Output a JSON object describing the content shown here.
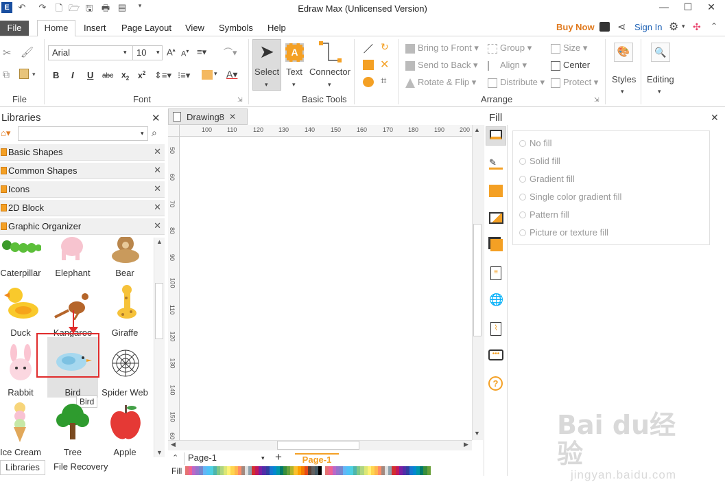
{
  "window": {
    "title": "Edraw Max (Unlicensed Version)"
  },
  "tabs": {
    "file": "File",
    "items": [
      "Home",
      "Insert",
      "Page Layout",
      "View",
      "Symbols",
      "Help"
    ],
    "buy_now": "Buy Now",
    "sign_in": "Sign In"
  },
  "ribbon": {
    "file_group": "File",
    "font": {
      "name": "Arial",
      "size": "10",
      "group": "Font"
    },
    "basic_tools": {
      "select": "Select",
      "text": "Text",
      "connector": "Connector",
      "group": "Basic Tools"
    },
    "arrange": {
      "bring_to_front": "Bring to Front",
      "send_to_back": "Send to Back",
      "rotate_flip": "Rotate & Flip",
      "group_btn": "Group",
      "align": "Align",
      "distribute": "Distribute",
      "size": "Size",
      "center": "Center",
      "protect": "Protect",
      "group": "Arrange"
    },
    "styles": "Styles",
    "editing": "Editing"
  },
  "libraries": {
    "title": "Libraries",
    "categories": [
      "Basic Shapes",
      "Common Shapes",
      "Icons",
      "2D Block",
      "Graphic Organizer"
    ],
    "shapes": [
      "Caterpillar",
      "Elephant",
      "Bear",
      "Duck",
      "Kangaroo",
      "Giraffe",
      "Rabbit",
      "Bird",
      "Spider Web",
      "Ice Cream",
      "Tree",
      "Apple"
    ],
    "tooltip": "Bird",
    "tabs": [
      "Libraries",
      "File Recovery"
    ]
  },
  "document": {
    "tab": "Drawing8",
    "page_select": "Page-1",
    "page_tab": "Page-1",
    "fill_label": "Fill"
  },
  "ruler": {
    "h": [
      "100",
      "110",
      "120",
      "130",
      "140",
      "150",
      "160",
      "170",
      "180",
      "190",
      "200"
    ],
    "v": [
      "50",
      "60",
      "70",
      "80",
      "90",
      "100",
      "110",
      "120",
      "130",
      "140",
      "150",
      "60"
    ]
  },
  "fill_panel": {
    "title": "Fill",
    "options": [
      "No fill",
      "Solid fill",
      "Gradient fill",
      "Single color gradient fill",
      "Pattern fill",
      "Picture or texture fill"
    ]
  },
  "watermark": {
    "brand": "Bai du经验",
    "url": "jingyan.baidu.com"
  },
  "colors": {
    "accent": "#f4a024",
    "buy": "#e07a1f",
    "link": "#1a5fb4",
    "highlight": "#e02b2b"
  }
}
